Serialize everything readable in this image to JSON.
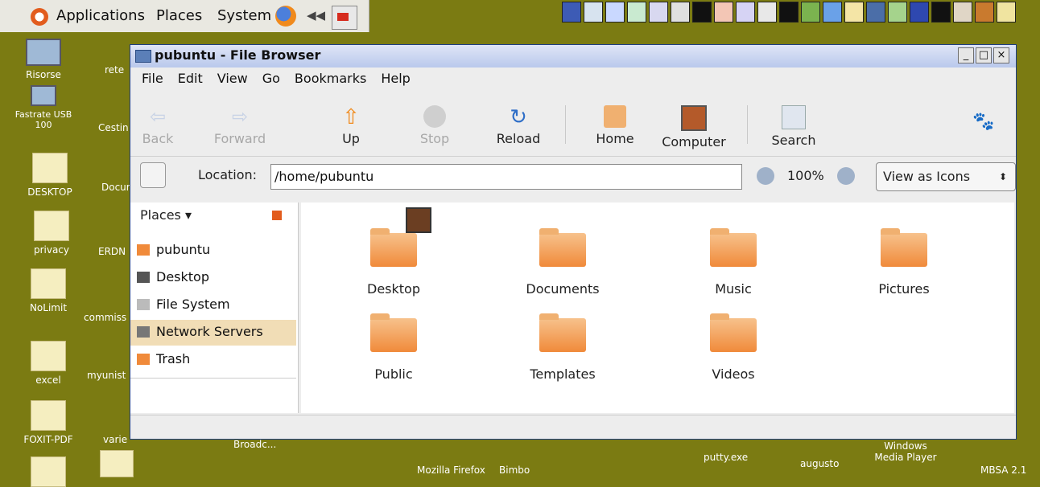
{
  "panel": {
    "menus": [
      "Applications",
      "Places",
      "System"
    ]
  },
  "desktop": {
    "left_col": [
      {
        "label": "Risorse"
      },
      {
        "label": "Fastrate USB 100"
      },
      {
        "label": "DESKTOP"
      },
      {
        "label": "privacy"
      },
      {
        "label": "NoLimit"
      },
      {
        "label": "excel"
      },
      {
        "label": "FOXIT-PDF"
      }
    ],
    "second_col": [
      {
        "label": "rete"
      },
      {
        "label": "Cestin"
      },
      {
        "label": "Docum"
      },
      {
        "label": "ERDN"
      },
      {
        "label": "commiss"
      },
      {
        "label": "myunist"
      },
      {
        "label": "varie"
      }
    ],
    "bottom": [
      {
        "label": "Broadc..."
      },
      {
        "label": "Mozilla Firefox"
      },
      {
        "label": "Bimbo"
      },
      {
        "label": "putty.exe"
      },
      {
        "label": "augusto"
      },
      {
        "label": "Windows Media Player"
      },
      {
        "label": "MBSA 2.1"
      }
    ]
  },
  "window": {
    "title": "pubuntu - File Browser",
    "controls": [
      "_",
      "□",
      "×"
    ],
    "menubar": [
      "File",
      "Edit",
      "View",
      "Go",
      "Bookmarks",
      "Help"
    ],
    "toolbar": {
      "back": "Back",
      "forward": "Forward",
      "up": "Up",
      "stop": "Stop",
      "reload": "Reload",
      "home": "Home",
      "computer": "Computer",
      "search": "Search"
    },
    "location": {
      "label": "Location:",
      "value": "/home/pubuntu",
      "zoom": "100%",
      "view_mode": "View as Icons"
    },
    "sidebar": {
      "header": "Places",
      "items": [
        "pubuntu",
        "Desktop",
        "File System",
        "Network Servers",
        "Trash"
      ],
      "selected": "Network Servers"
    },
    "files": [
      "Desktop",
      "Documents",
      "Music",
      "Pictures",
      "Public",
      "Templates",
      "Videos"
    ]
  },
  "colors": {
    "desktop_bg": "#7b7b12",
    "folder_orange": "#f08a3a",
    "selection": "#f1ddb6"
  }
}
